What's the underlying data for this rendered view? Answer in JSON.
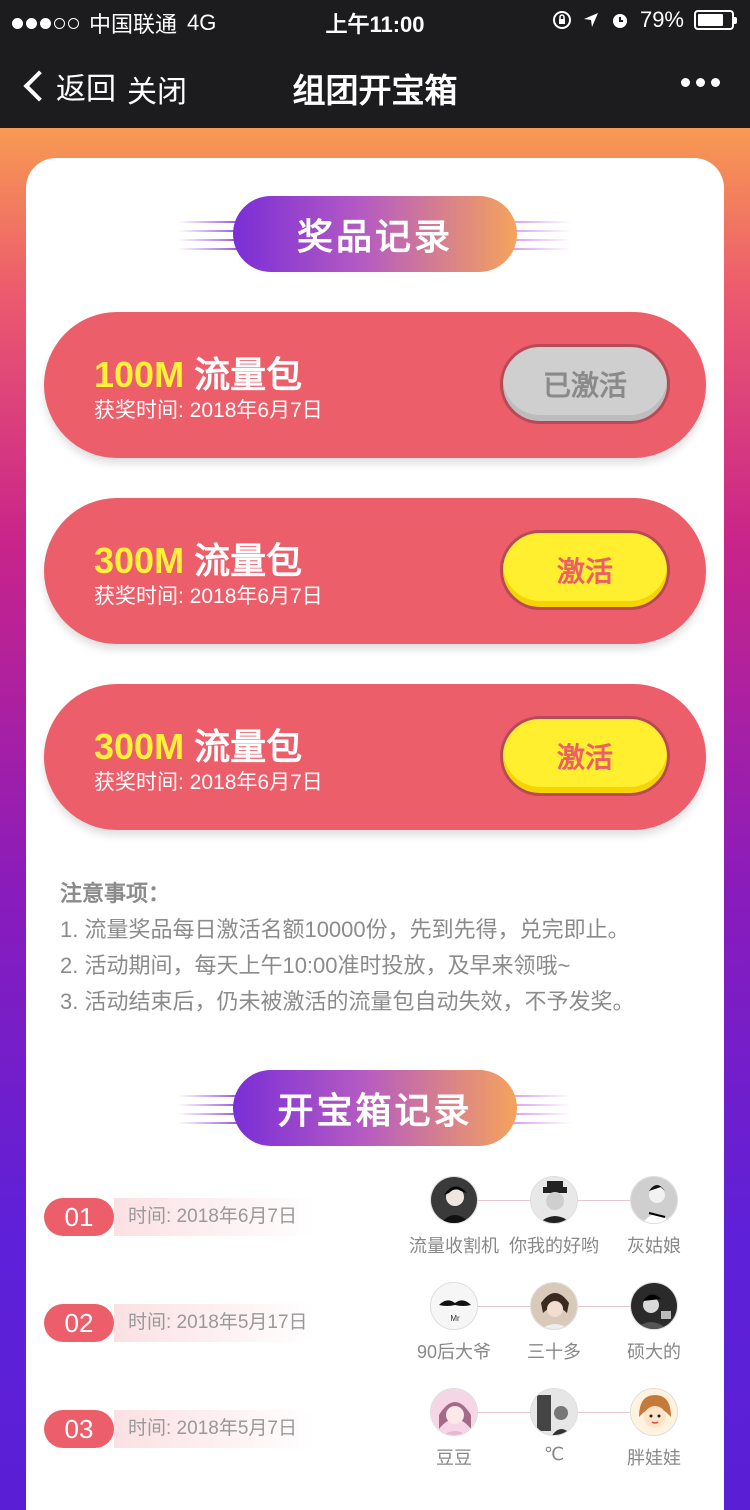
{
  "status_bar": {
    "carrier": "中国联通",
    "network": "4G",
    "time": "上午11:00",
    "battery": "79%",
    "battery_level": 0.79
  },
  "nav": {
    "back_label": "返回",
    "close_label": "关闭",
    "title": "组团开宝箱"
  },
  "prize_section": {
    "heading": "奖品记录",
    "items": [
      {
        "size": "100M",
        "name": "流量包",
        "time": "获奖时间: 2018年6月7日",
        "button": "已激活",
        "state": "used"
      },
      {
        "size": "300M",
        "name": "流量包",
        "time": "获奖时间: 2018年6月7日",
        "button": "激活",
        "state": "active"
      },
      {
        "size": "300M",
        "name": "流量包",
        "time": "获奖时间: 2018年6月7日",
        "button": "激活",
        "state": "active"
      }
    ]
  },
  "notes": {
    "title": "注意事项：",
    "lines": [
      "1. 流量奖品每日激活名额10000份，先到先得，兑完即止。",
      "2. 活动期间，每天上午10:00准时投放，及早来领哦~",
      "3. 活动结束后，仍未被激活的流量包自动失效，不予发奖。"
    ]
  },
  "record_section": {
    "heading": "开宝箱记录",
    "records": [
      {
        "index": "01",
        "time": "时间: 2018年6月7日",
        "members": [
          "流量收割机",
          "你我的好哟",
          "灰姑娘"
        ]
      },
      {
        "index": "02",
        "time": "时间: 2018年5月17日",
        "members": [
          "90后大爷",
          "三十多",
          "硕大的"
        ]
      },
      {
        "index": "03",
        "time": "时间: 2018年5月7日",
        "members": [
          "豆豆",
          "℃",
          "胖娃娃"
        ]
      }
    ],
    "avatar_badge": "Mr"
  },
  "colors": {
    "accent_red": "#ec5e6a",
    "accent_yellow": "#ffef2e",
    "heading_gradient_start": "#7a2ed6",
    "heading_gradient_end": "#f5a35c"
  }
}
